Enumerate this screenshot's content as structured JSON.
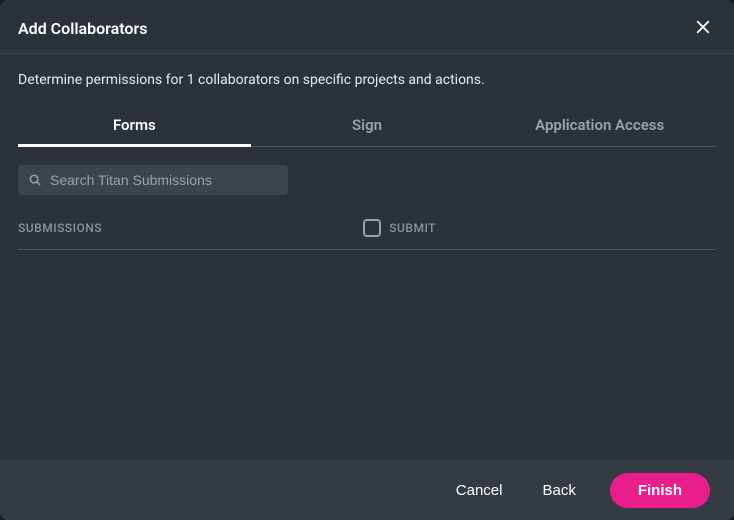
{
  "header": {
    "title": "Add  Collaborators"
  },
  "body": {
    "description": "Determine permissions for 1 collaborators on specific projects and actions."
  },
  "tabs": [
    {
      "label": "Forms",
      "active": true
    },
    {
      "label": "Sign",
      "active": false
    },
    {
      "label": "Application Access",
      "active": false
    }
  ],
  "search": {
    "placeholder": "Search Titan Submissions",
    "value": ""
  },
  "table": {
    "columns": {
      "submissions": "SUBMISSIONS",
      "submit": "SUBMIT"
    }
  },
  "footer": {
    "cancel": "Cancel",
    "back": "Back",
    "finish": "Finish"
  }
}
